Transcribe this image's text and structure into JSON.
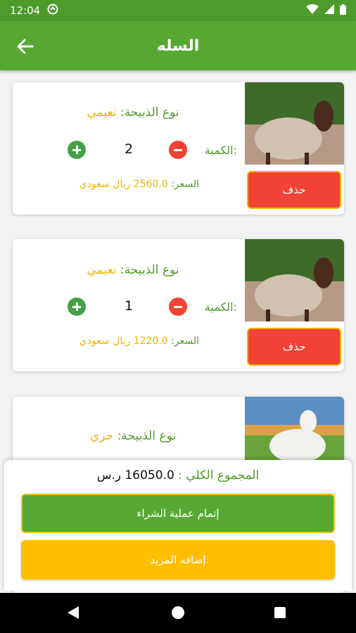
{
  "status_bar": {
    "time": "12:04"
  },
  "app_bar": {
    "title": "السله"
  },
  "labels": {
    "type_label": "نوع الذبيحة:",
    "quantity_label": "الكمية:",
    "price_label": "السعر:",
    "delete": "حذف"
  },
  "items": [
    {
      "type": "نعيمي",
      "quantity": "2",
      "price": "2560.0 ريال سعودي"
    },
    {
      "type": "نعيمي",
      "quantity": "1",
      "price": "1220.0 ريال سعودي"
    },
    {
      "type": "حري"
    }
  ],
  "summary": {
    "total_label": "المجموع الكلي :",
    "total_value": "16050.0 ر.س",
    "checkout": "إتمام عملية الشراء",
    "add_more": "إضافه المزيد"
  },
  "colors": {
    "primary": "#57a832",
    "accent": "#ffbf00",
    "danger": "#f14336"
  },
  "icons": [
    "back-arrow-icon",
    "minus-icon",
    "plus-icon",
    "wifi-icon",
    "signal-icon",
    "battery-icon"
  ]
}
